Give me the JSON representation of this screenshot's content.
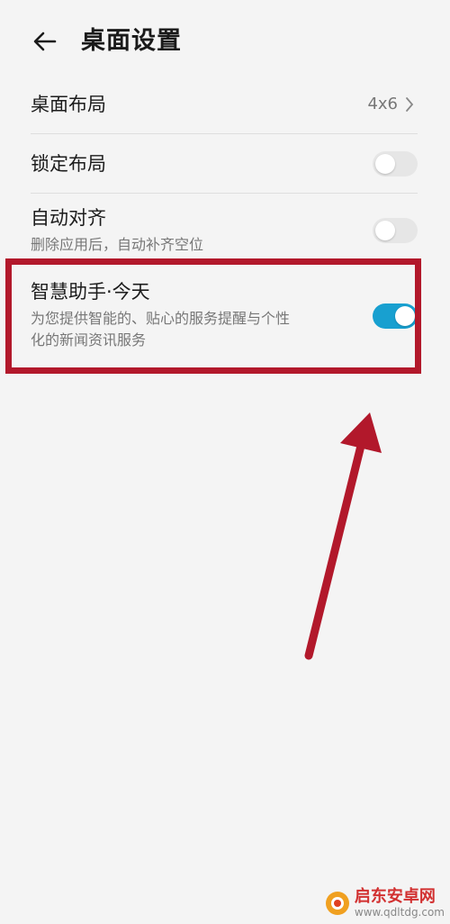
{
  "header": {
    "title": "桌面设置",
    "back_icon": "arrow-left-icon"
  },
  "items": [
    {
      "title": "桌面布局",
      "value": "4x6"
    },
    {
      "title": "锁定布局",
      "toggle": false
    },
    {
      "title": "自动对齐",
      "subtitle": "删除应用后，自动补齐空位",
      "toggle": false
    },
    {
      "title": "智慧助手·今天",
      "subtitle_line1": "为您提供智能的、贴心的服务提醒与个性",
      "subtitle_line2": "化的新闻资讯服务",
      "toggle": true
    }
  ],
  "watermark": {
    "text": "启东安卓网",
    "url": "www.qdltdg.com"
  },
  "colors": {
    "toggle_on": "#18a0d0",
    "highlight": "#b2182b"
  }
}
